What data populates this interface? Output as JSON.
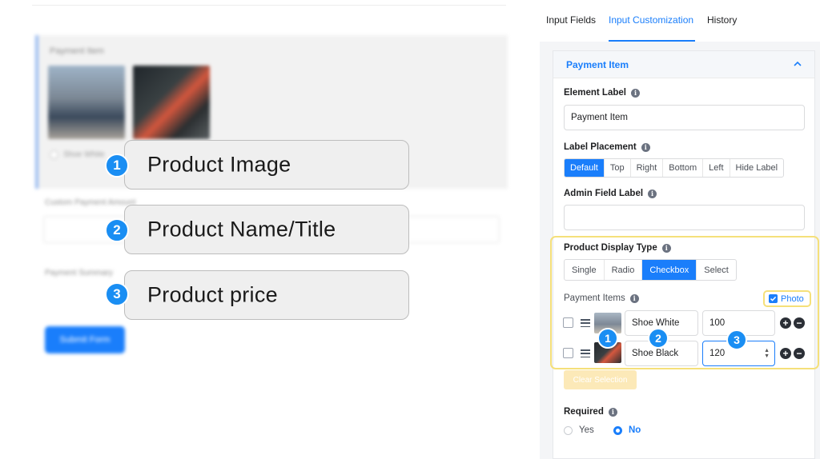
{
  "preview": {
    "payment_item_label": "Payment Item",
    "option_label": "Shoe White",
    "custom_amount_label": "Custom Payment Amount",
    "summary_label": "Payment Summary",
    "submit_label": "Submit Form"
  },
  "callouts": [
    {
      "number": "1",
      "label": "Product Image"
    },
    {
      "number": "2",
      "label": "Product Name/Title"
    },
    {
      "number": "3",
      "label": "Product price"
    }
  ],
  "tabs": [
    {
      "label": "Input Fields"
    },
    {
      "label": "Input Customization"
    },
    {
      "label": "History"
    }
  ],
  "card": {
    "title": "Payment Item",
    "element_label": {
      "label": "Element Label",
      "value": "Payment Item"
    },
    "label_placement": {
      "label": "Label Placement",
      "options": [
        "Default",
        "Top",
        "Right",
        "Bottom",
        "Left",
        "Hide Label"
      ],
      "selected": "Default"
    },
    "admin_field_label": {
      "label": "Admin Field Label",
      "value": ""
    },
    "product_display_type": {
      "label": "Product Display Type",
      "options": [
        "Single",
        "Radio",
        "Checkbox",
        "Select"
      ],
      "selected": "Checkbox"
    },
    "payment_items": {
      "label": "Payment Items",
      "photo_label": "Photo",
      "rows": [
        {
          "name": "Shoe White",
          "price": "100"
        },
        {
          "name": "Shoe Black",
          "price": "120"
        }
      ],
      "row_badges": [
        "1",
        "2",
        "3"
      ]
    },
    "clear_selection_label": "Clear Selection",
    "required": {
      "label": "Required",
      "options": [
        "Yes",
        "No"
      ],
      "selected": "No"
    }
  },
  "colors": {
    "accent": "#1a7efb",
    "badge": "#1a8ef3",
    "highlight": "#f5e07a"
  }
}
